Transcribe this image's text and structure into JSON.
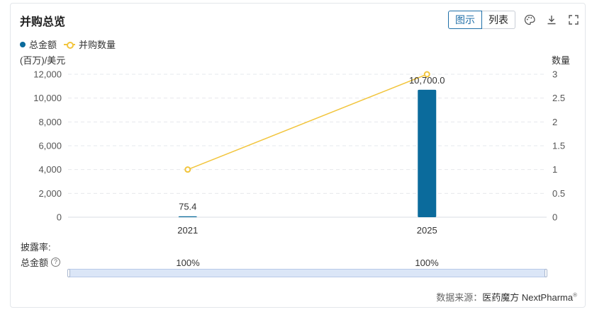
{
  "header": {
    "title": "并购总览",
    "view_chart": "图示",
    "view_list": "列表"
  },
  "icons": [
    "palette-icon",
    "download-icon",
    "fullscreen-icon"
  ],
  "colors": {
    "bar": "#0b6b9c",
    "line": "#f2c53d",
    "accent": "#1f6fa8"
  },
  "chart_data": {
    "type": "bar",
    "categories": [
      "2021",
      "2025"
    ],
    "series": [
      {
        "name": "总金额",
        "type": "bar",
        "axis": "left",
        "values": [
          75.4,
          10700
        ],
        "labels": [
          "75.4",
          "10,700.0"
        ]
      },
      {
        "name": "并购数量",
        "type": "line",
        "axis": "right",
        "values": [
          1,
          3
        ]
      }
    ],
    "y_left": {
      "label": "(百万)/美元",
      "ylim": [
        0,
        12000
      ],
      "ticks": [
        "0",
        "2,000",
        "4,000",
        "6,000",
        "8,000",
        "10,000",
        "12,000"
      ]
    },
    "y_right": {
      "label": "数量",
      "ylim": [
        0,
        3
      ],
      "ticks": [
        "0",
        "0.5",
        "1",
        "1.5",
        "2",
        "2.5",
        "3"
      ]
    },
    "grid": true,
    "legend": "top-left"
  },
  "disclosure": {
    "label": "披露率:",
    "metric_label": "总金额",
    "values": [
      "100%",
      "100%"
    ]
  },
  "source": {
    "prefix": "数据来源：",
    "brand": "医药魔方 NextPharma",
    "mark": "®"
  }
}
